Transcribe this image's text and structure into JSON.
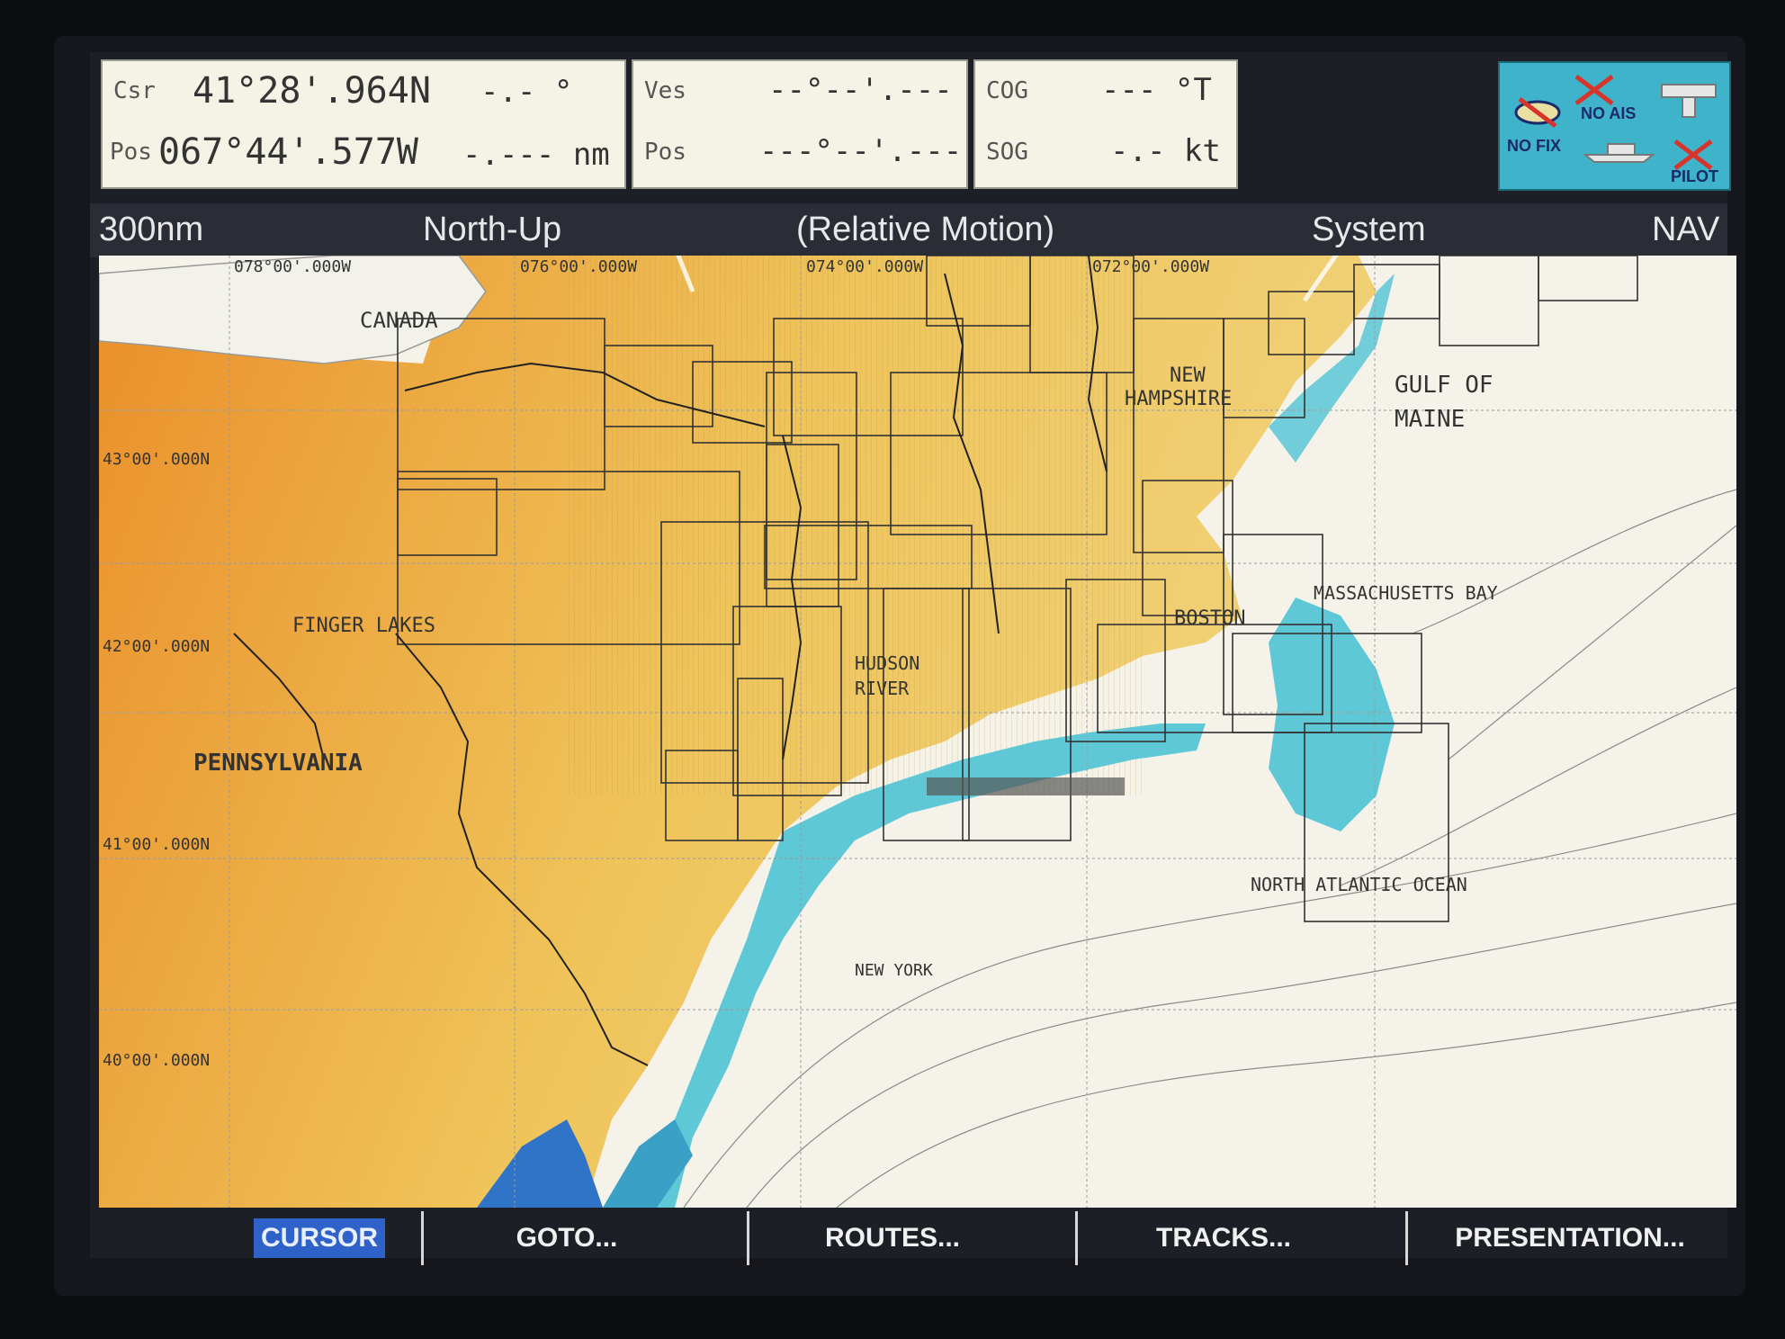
{
  "cursor_box": {
    "csr_label": "Csr",
    "pos_label": "Pos",
    "lat": "41°28'.964N",
    "lon": "067°44'.577W",
    "bearing": "-.- °",
    "range": "-.--- nm"
  },
  "vessel_box": {
    "ves_label": "Ves",
    "pos_label": "Pos",
    "lat": "--°--'.---",
    "lon": "---°--'.---"
  },
  "course_box": {
    "cog_label": "COG",
    "cog_value": "--- °T",
    "sog_label": "SOG",
    "sog_value": "-.- kt"
  },
  "status": {
    "no_fix": "NO FIX",
    "no_ais": "NO AIS",
    "pilot": "PILOT"
  },
  "mode_bar": {
    "range": "300nm",
    "orientation": "North-Up",
    "motion": "(Relative Motion)",
    "system": "System",
    "mode": "NAV"
  },
  "map": {
    "lon_labels": [
      "078°00'.000W",
      "076°00'.000W",
      "074°00'.000W",
      "072°00'.000W"
    ],
    "lat_labels": [
      "43°00'.000N",
      "42°00'.000N",
      "41°00'.000N",
      "40°00'.000N"
    ],
    "places": {
      "canada": "CANADA",
      "new_hampshire_1": "NEW",
      "new_hampshire_2": "HAMPSHIRE",
      "gulf_of_maine_1": "GULF OF",
      "gulf_of_maine_2": "MAINE",
      "massachusetts_bay": "MASSACHUSETTS BAY",
      "finger_lakes": "FINGER LAKES",
      "hudson_river_1": "HUDSON",
      "hudson_river_2": "RIVER",
      "boston": "BOSTON",
      "pennsylvania": "PENNSYLVANIA",
      "north_atlantic": "NORTH ATLANTIC OCEAN",
      "new_york": "NEW YORK"
    },
    "colors": {
      "land_light": "#efcf6e",
      "land_dark": "#ea8f2a",
      "water": "#f5f3e9",
      "shallow": "#4fc3d4"
    }
  },
  "softkeys": {
    "cursor": "CURSOR",
    "goto": "GOTO...",
    "routes": "ROUTES...",
    "tracks": "TRACKS...",
    "presentation": "PRESENTATION..."
  }
}
